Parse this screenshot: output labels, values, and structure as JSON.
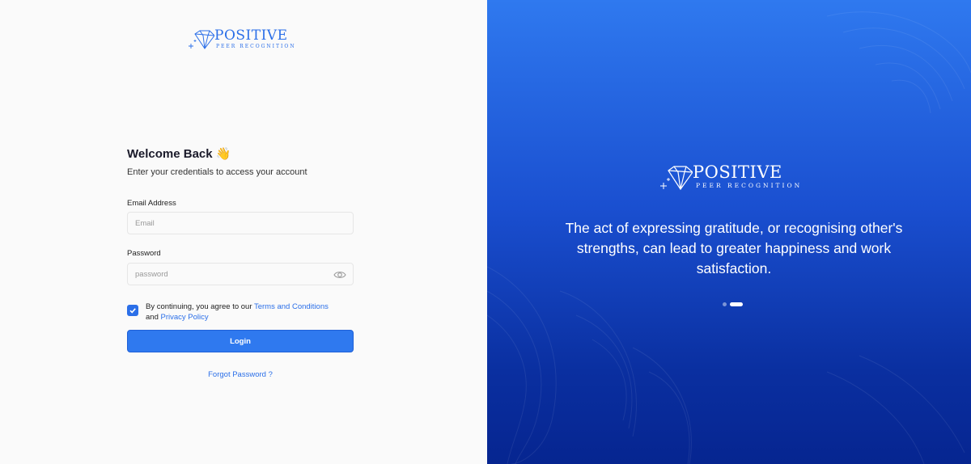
{
  "brand": {
    "name": "POSITIVE",
    "tagline": "PEER RECOGNITION",
    "icon": "diamond-icon"
  },
  "login": {
    "title": "Welcome Back 👋",
    "subtitle": "Enter your credentials to access your account",
    "email_label": "Email Address",
    "email_placeholder": "Email",
    "email_value": "",
    "password_label": "Password",
    "password_placeholder": "password",
    "password_value": "",
    "agree_checked": true,
    "agree_text": "By continuing, you agree to our",
    "terms_link": "Terms and Conditions",
    "and_text": "and",
    "privacy_link": "Privacy Policy",
    "login_button": "Login",
    "forgot_link": "Forgot Password ?"
  },
  "carousel": {
    "quote": "The act of expressing gratitude, or recognising other's strengths, can lead to greater happiness and work satisfaction.",
    "slide_count": 2,
    "active_slide": 2
  },
  "colors": {
    "accent": "#2f79ef",
    "panel_top": "#2f79ef",
    "panel_bottom": "#062590"
  }
}
